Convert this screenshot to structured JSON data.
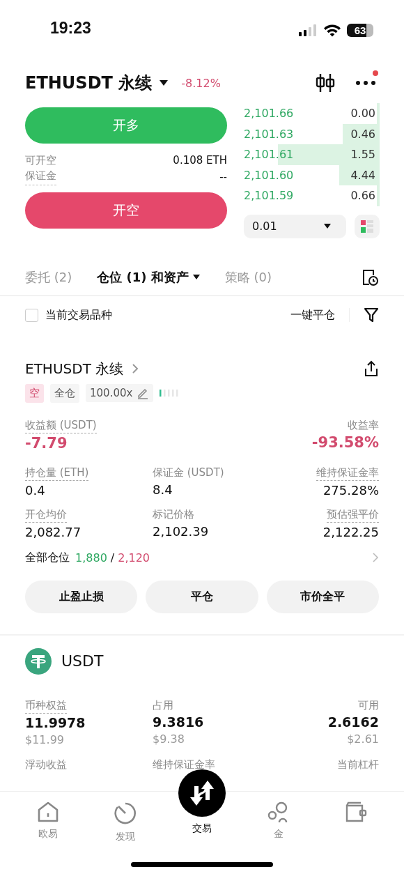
{
  "status_bar": {
    "time": "19:23",
    "battery": "63"
  },
  "header": {
    "symbol": "ETHUSDT 永续",
    "change": "-8.12%",
    "menu_notification": true
  },
  "trade": {
    "long_button": "开多",
    "short_button": "开空",
    "info": [
      {
        "label": "可开空",
        "value": "0.108 ETH"
      },
      {
        "label": "保证金",
        "value": "--"
      }
    ]
  },
  "order_book": {
    "rows": [
      {
        "price": "2,101.66",
        "amount": "0.00"
      },
      {
        "price": "2,101.63",
        "amount": "0.46"
      },
      {
        "price": "2,101.61",
        "amount": "1.55"
      },
      {
        "price": "2,101.60",
        "amount": "4.44"
      },
      {
        "price": "2,101.59",
        "amount": "0.66"
      }
    ],
    "precision": "0.01"
  },
  "tabs": [
    {
      "label": "委托 (2)",
      "selected": false,
      "dropdown": false
    },
    {
      "label": "仓位 (1) 和资产",
      "selected": true,
      "dropdown": true
    },
    {
      "label": "策略 (0)",
      "selected": false,
      "dropdown": false
    }
  ],
  "filter": {
    "checkbox_label": "当前交易品种",
    "checked": false,
    "close_all": "一键平仓"
  },
  "position": {
    "title": "ETHUSDT 永续",
    "side": "空",
    "margin_mode": "全仓",
    "leverage": "100.00x",
    "pnl_label": "收益额 (USDT)",
    "pnl": "-7.79",
    "roe_label": "收益率",
    "roe": "-93.58%",
    "stats": [
      {
        "label": "持仓量 (ETH)",
        "value": "0.4",
        "dashed": true
      },
      {
        "label": "保证金 (USDT)",
        "value": "8.4",
        "dashed": false
      },
      {
        "label": "维持保证金率",
        "value": "275.28%",
        "dashed": true
      },
      {
        "label": "开仓均价",
        "value": "2,082.77",
        "dashed": true
      },
      {
        "label": "标记价格",
        "value": "2,102.39",
        "dashed": false
      },
      {
        "label": "预估强平价",
        "value": "2,122.25",
        "dashed": true
      }
    ],
    "all_positions_label": "全部仓位",
    "long_count": "1,880",
    "separator": "/",
    "short_count": "2,120",
    "buttons": [
      "止盈止损",
      "平仓",
      "市价全平"
    ]
  },
  "asset": {
    "name": "USDT",
    "stats": [
      {
        "label": "币种权益",
        "value": "11.9978",
        "sub": "$11.99",
        "dashed": true
      },
      {
        "label": "占用",
        "value": "9.3816",
        "sub": "$9.38",
        "dashed": false
      },
      {
        "label": "可用",
        "value": "2.6162",
        "sub": "$2.61",
        "dashed": false
      }
    ],
    "more_labels": [
      "浮动收益",
      "维持保证金率",
      "当前杠杆"
    ]
  },
  "nav": [
    {
      "kind": "home",
      "label": "欧易",
      "selected": false
    },
    {
      "kind": "discover",
      "label": "发现",
      "selected": false
    },
    {
      "kind": "trade",
      "label": "交易",
      "selected": true
    },
    {
      "kind": "finance",
      "label": "金",
      "selected": false
    },
    {
      "kind": "wallet",
      "selected": false
    }
  ]
}
